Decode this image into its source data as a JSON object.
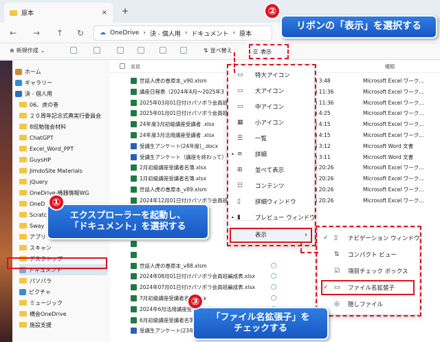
{
  "window": {
    "tab_title": "原本",
    "tab_close": "×",
    "new_tab": "+"
  },
  "navigation": {
    "back": "←",
    "forward": "→",
    "up": "↑",
    "refresh": "↻",
    "breadcrumb": [
      "OneDrive",
      "決 - 個人用",
      "ドキュメント",
      "原本"
    ],
    "separator": "›"
  },
  "toolbar": {
    "new_label": "新規作成",
    "sort_label": "並べ替え",
    "view_label": "表示"
  },
  "sidebar": {
    "items": [
      {
        "label": "ホーム",
        "icon": "home-icon"
      },
      {
        "label": "ギャラリー",
        "icon": "gallery-icon"
      },
      {
        "label": "決 - 個人用",
        "icon": "cloud-icon"
      },
      {
        "label": "06、虎の巻",
        "icon": "folder-icon"
      },
      {
        "label": "２０周年記念式典実行委員会",
        "icon": "folder-icon"
      },
      {
        "label": "8班勉強会材料",
        "icon": "folder-icon"
      },
      {
        "label": "ChatGPT",
        "icon": "folder-icon"
      },
      {
        "label": "Excel_Word_PPT",
        "icon": "folder-icon"
      },
      {
        "label": "GuysHP",
        "icon": "folder-icon"
      },
      {
        "label": "JimdoSite Materials",
        "icon": "folder-icon"
      },
      {
        "label": "jQuery",
        "icon": "folder-icon"
      },
      {
        "label": "OneDrive-機器情報WG",
        "icon": "folder-icon"
      },
      {
        "label": "OneD",
        "icon": "folder-icon"
      },
      {
        "label": "Scratch",
        "icon": "folder-icon"
      },
      {
        "label": "Sway",
        "icon": "folder-icon"
      },
      {
        "label": "アプリ",
        "icon": "folder-icon"
      },
      {
        "label": "スキャン",
        "icon": "folder-icon"
      },
      {
        "label": "デスクトップ",
        "icon": "folder-icon"
      },
      {
        "label": "ドキュメント",
        "icon": "document-icon"
      },
      {
        "label": "パソパラ",
        "icon": "folder-icon"
      },
      {
        "label": "ピクチャ",
        "icon": "picture-icon"
      },
      {
        "label": "ミュージック",
        "icon": "folder-icon"
      },
      {
        "label": "横会OneDrive",
        "icon": "folder-icon"
      },
      {
        "label": "施設支援",
        "icon": "folder-icon"
      }
    ]
  },
  "files": {
    "columns": {
      "name": "名前",
      "type": "種類"
    },
    "rows": [
      {
        "name": "世話人虎の巻原本_v90.xlsm",
        "date": "25/03/03 (月) 3:48",
        "type": "Microsoft Excel ワーク…",
        "kind": "excel"
      },
      {
        "name": "講座日程表（2024年4月～2025年3",
        "date": "25/03/01 (土) 11:36",
        "type": "Microsoft Excel ワーク…",
        "kind": "excel"
      },
      {
        "name": "2025年03月01日付けパソボラ会員班",
        "date": "25/03/01 (土) 11:36",
        "type": "Microsoft Excel ワーク…",
        "kind": "excel"
      },
      {
        "name": "2025年01月01日付けパソボラ会員班",
        "date": "25/02/28 (金) 4:25",
        "type": "Microsoft Excel ワーク…",
        "kind": "excel"
      },
      {
        "name": "24年度3月初級講座受講者 .xlsx",
        "date": "25/02/28 (金) 4:15",
        "type": "Microsoft Excel ワーク…",
        "kind": "excel"
      },
      {
        "name": "24年度3月活用講座受講者 .xlsx",
        "date": "25/02/28 (金) 4:15",
        "type": "Microsoft Excel ワーク…",
        "kind": "excel"
      },
      {
        "name": "受講生アンケート(24年度)_.docx",
        "date": "25/02/28 (金) 3:12",
        "type": "Microsoft Word 文書",
        "kind": "word"
      },
      {
        "name": "受講生アンケート（講座を終わって）",
        "date": "25/02/28 (金) 3:11",
        "type": "Microsoft Word 文書",
        "kind": "word"
      },
      {
        "name": "2月初級講座受講者名簿.xlsx",
        "date": "25/01/23 (木) 20:26",
        "type": "Microsoft Excel ワーク…",
        "kind": "excel"
      },
      {
        "name": "1月初級講座受講者名簿.xlsx",
        "date": "24/12/17 (火) 20:26",
        "type": "Microsoft Excel ワーク…",
        "kind": "excel"
      },
      {
        "name": "世話人虎の巻原本_v89.xlsm",
        "date": "24/12/12 (木) 20:26",
        "type": "Microsoft Excel ワーク…",
        "kind": "excel"
      },
      {
        "name": "2024年12月01日付けパソボラ会員班",
        "date": "24/12/06 (金) 20:26",
        "type": "Microsoft Excel ワーク…",
        "kind": "excel"
      },
      {
        "name": "",
        "date": "",
        "type": "",
        "kind": "excel"
      },
      {
        "name": "",
        "date": "",
        "type": "",
        "kind": "excel"
      },
      {
        "name": "",
        "date": "",
        "type": "",
        "kind": "excel"
      },
      {
        "name": "",
        "date": "",
        "type": "",
        "kind": "excel"
      },
      {
        "name": "",
        "date": "",
        "type": "",
        "kind": "excel"
      },
      {
        "name": "世話人虎の巻原本_v88.xlsm",
        "date": "",
        "type": "",
        "kind": "excel"
      },
      {
        "name": "2024年08月01日付けパソボラ会員班編成表.xlsx",
        "date": "",
        "type": "",
        "kind": "excel"
      },
      {
        "name": "2024年07月01日付けパソボラ会員班編成表.xlsx",
        "date": "",
        "type": "",
        "kind": "excel"
      },
      {
        "name": "7月初級講座受講者名簿.xlsx",
        "date": "",
        "type": "",
        "kind": "excel"
      },
      {
        "name": "2024年6月活用講座受講者名簿.xlsx",
        "date": "",
        "type": "",
        "kind": "excel"
      },
      {
        "name": "6月初級講座受講者名簿.xlsx",
        "date": "",
        "type": "",
        "kind": "excel"
      },
      {
        "name": "受講生アンケート(23年",
        "date": "",
        "type": "",
        "kind": "word"
      }
    ]
  },
  "view_menu": {
    "items": [
      {
        "label": "特大アイコン",
        "icon": "monitor-icon",
        "dot": ""
      },
      {
        "label": "大アイコン",
        "icon": "monitor-icon",
        "dot": ""
      },
      {
        "label": "中アイコン",
        "icon": "monitor-icon",
        "dot": ""
      },
      {
        "label": "小アイコン",
        "icon": "grid-icon",
        "dot": ""
      },
      {
        "label": "一覧",
        "icon": "list-icon",
        "dot": ""
      },
      {
        "label": "詳細",
        "icon": "details-icon",
        "dot": "•"
      },
      {
        "label": "並べて表示",
        "icon": "tiles-icon",
        "dot": ""
      },
      {
        "label": "コンテンツ",
        "icon": "content-icon",
        "dot": ""
      },
      {
        "label": "詳細ウィンドウ",
        "icon": "pane-icon",
        "dot": ""
      },
      {
        "label": "プレビュー ウィンドウ",
        "icon": "preview-icon",
        "dot": "•"
      }
    ],
    "show_label": "表示",
    "show_arrow": "›"
  },
  "show_submenu": {
    "items": [
      {
        "label": "ナビゲーション ウィンドウ",
        "check": "✓"
      },
      {
        "label": "コンパクト ビュー",
        "check": ""
      },
      {
        "label": "項目チェック ボックス",
        "check": ""
      },
      {
        "label": "ファイル名拡張子",
        "check": "✓"
      },
      {
        "label": "隠しファイル",
        "check": ""
      }
    ]
  },
  "annotations": {
    "step1_badge": "①",
    "step1_line1": "エクスプローラーを起動し、",
    "step1_line2": "「ドキュメント」を選択する",
    "step2_badge": "②",
    "step2_text": "リボンの「表示」を選択する",
    "step3_badge": "③",
    "step3_line1": "「ファイル名拡張子」を",
    "step3_line2": "チェックする"
  },
  "colors": {
    "callout_blue": "#2f7ce0",
    "annotation_red": "#e0111e",
    "excel_green": "#1f7a44",
    "word_blue": "#2b5fb8"
  }
}
